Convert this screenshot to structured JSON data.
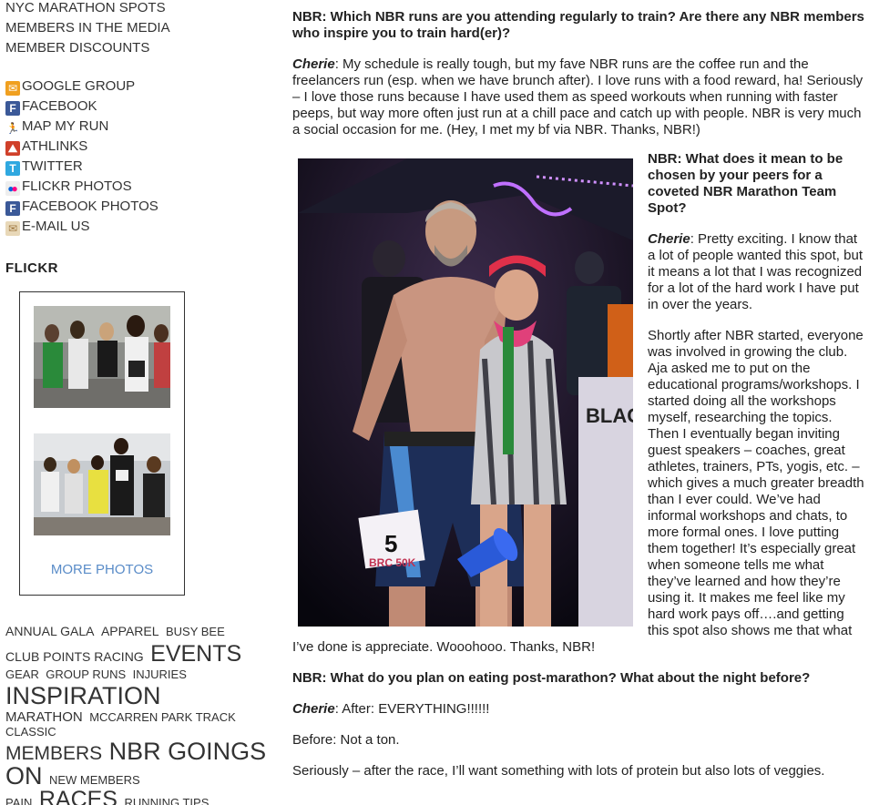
{
  "sidebar": {
    "top_links": [
      "NYC MARATHON SPOTS",
      "MEMBERS IN THE MEDIA",
      "MEMBER DISCOUNTS"
    ],
    "social_links": [
      {
        "label": "GOOGLE GROUP",
        "icon": "google-group-icon",
        "color": "#f0a020"
      },
      {
        "label": "FACEBOOK",
        "icon": "facebook-icon",
        "color": "#3b5998"
      },
      {
        "label": "MAP MY RUN",
        "icon": "map-my-run-icon",
        "color": "#1a4a8a"
      },
      {
        "label": "ATHLINKS",
        "icon": "athlinks-icon",
        "color": "#d0402a"
      },
      {
        "label": "TWITTER",
        "icon": "twitter-icon",
        "color": "#2fa8e0"
      },
      {
        "label": "FLICKR PHOTOS",
        "icon": "flickr-icon",
        "color": "#ff0084"
      },
      {
        "label": "FACEBOOK PHOTOS",
        "icon": "facebook-icon",
        "color": "#3b5998"
      },
      {
        "label": "E-MAIL US",
        "icon": "email-icon",
        "color": "#c8a070"
      }
    ],
    "flickr_heading": "FLICKR",
    "more_photos": "MORE PHOTOS",
    "tags": [
      "ANNUAL GALA",
      "APPAREL",
      "BUSY BEE",
      "CLUB POINTS RACING",
      "EVENTS",
      "GEAR",
      "GROUP RUNS",
      "INJURIES",
      "INSPIRATION",
      "MARATHON",
      "MCCARREN PARK TRACK CLASSIC",
      "MEMBERS",
      "NBR GOINGS ON",
      "NEW MEMBERS",
      "PAIN",
      "RACES",
      "RUNNING TIPS"
    ]
  },
  "article": {
    "q1": "NBR: Which NBR runs are you attending regularly to train? Are there any NBR members who inspire you to train hard(er)?",
    "speaker": "Cherie",
    "a1": ": My schedule is really tough, but my fave NBR runs are the coffee run and the freelancers run (esp. when we have brunch after). I love runs with a food reward, ha! Seriously – I love those runs because I have used them as speed workouts when running with faster peeps, but way more often just run at a chill pace and catch up with people. NBR is very much a social occasion for me. (Hey, I met my bf via NBR. Thanks, NBR!)",
    "q2": "NBR: What does it mean to be chosen by your peers for a coveted NBR Marathon Team Spot?",
    "a2": ": Pretty exciting. I know that a lot of people wanted this spot, but it means a lot that I was recognized for a lot of the hard work I have put in over the years.",
    "a2b": "Shortly after NBR started, everyone was involved in growing the club. Aja asked me to put on the educational programs/workshops. I started doing all the workshops myself, researching the topics. Then I eventually began inviting guest speakers – coaches, great athletes, trainers, PTs, yogis, etc. – which gives a much greater breadth than I ever could. We’ve had informal workshops and chats, to more formal ones. I love putting them together! It’s especially great when someone tells me what they’ve learned and how they’re using it. It makes me feel like my hard work pays off….and getting this spot also shows me that what I’ve done is appreciate. Woooho­oo. Thanks, NBR!",
    "q3": "NBR: What do you plan on eating post-marathon? What about the night before?",
    "a3": ": After: EVERYTHING!!!!!!",
    "a3b": "Before: Not a ton.",
    "a3c": "Seriously – after the race, I’ll want something with lots of protein but also lots of veggies.",
    "photo_bib": "5",
    "photo_bib_text": "BRC 50K",
    "photo_sign": "BLAC"
  }
}
